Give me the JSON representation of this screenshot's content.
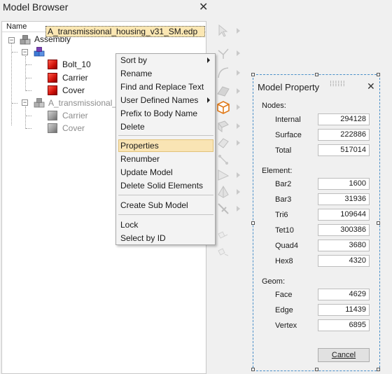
{
  "browser": {
    "title": "Model Browser",
    "close_icon": "close-icon",
    "column_header": "Name",
    "tree": {
      "root": "Assembly",
      "sub1": "A_transmissional_housing_v31_SM.edp",
      "sub1_children": [
        "Bolt_10",
        "Carrier",
        "Cover"
      ],
      "sub2": "A_transmissional_ho",
      "sub2_children": [
        "Carrier",
        "Cover"
      ]
    }
  },
  "context_menu": {
    "items": [
      {
        "label": "Sort by",
        "submenu": true
      },
      {
        "label": "Rename"
      },
      {
        "label": "Find and Replace Text"
      },
      {
        "label": "User Defined Names",
        "submenu": true
      },
      {
        "label": "Prefix to Body Name"
      },
      {
        "label": "Delete"
      },
      {
        "label": "Properties",
        "highlighted": true
      },
      {
        "label": "Renumber"
      },
      {
        "label": "Update Model"
      },
      {
        "label": "Delete Solid Elements"
      },
      {
        "label": "Create Sub Model"
      },
      {
        "label": "Lock"
      },
      {
        "label": "Select by ID"
      }
    ]
  },
  "dialog": {
    "title": "Model Property",
    "nodes_label": "Nodes:",
    "nodes": [
      {
        "label": "Internal",
        "value": "294128"
      },
      {
        "label": "Surface",
        "value": "222886"
      },
      {
        "label": "Total",
        "value": "517014"
      }
    ],
    "element_label": "Element:",
    "elements": [
      {
        "label": "Bar2",
        "value": "1600"
      },
      {
        "label": "Bar3",
        "value": "31936"
      },
      {
        "label": "Tri6",
        "value": "109644"
      },
      {
        "label": "Tet10",
        "value": "300386"
      },
      {
        "label": "Quad4",
        "value": "3680"
      },
      {
        "label": "Hex8",
        "value": "4320"
      }
    ],
    "geom_label": "Geom:",
    "geom": [
      {
        "label": "Face",
        "value": "4629"
      },
      {
        "label": "Edge",
        "value": "11439"
      },
      {
        "label": "Vertex",
        "value": "6895"
      }
    ],
    "cancel_label": "Cancel"
  },
  "toolbar": {
    "icons": [
      "select-arrow-icon",
      "line-icon",
      "arc-icon",
      "surface-icon",
      "solid-cube-icon",
      "face-icon",
      "edge-icon",
      "shell-icon",
      "triangle-icon",
      "tetra-icon",
      "probe-icon",
      "link-icon",
      "unlink-icon"
    ]
  },
  "colors": {
    "selection": "#fbe7b3",
    "menu_highlight": "#f9e4b4",
    "dialog_border": "#4a8fc8",
    "part_red": "#d0120a"
  }
}
